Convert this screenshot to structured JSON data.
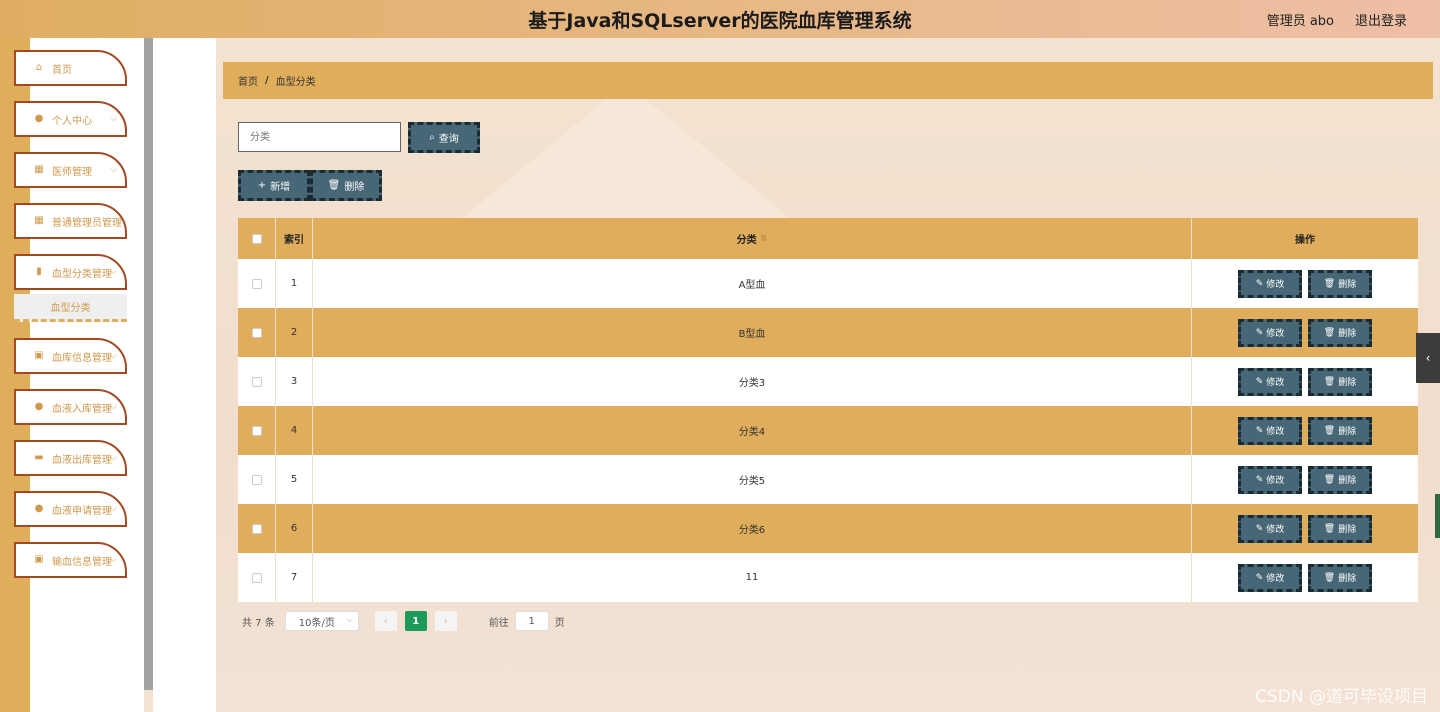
{
  "header": {
    "title": "基于Java和SQLserver的医院血库管理系统",
    "user": "管理员 abo",
    "logout": "退出登录"
  },
  "sidebar": {
    "items": [
      {
        "label": "首页",
        "icon": "home-icon",
        "glyph": "⌂",
        "chevron": false
      },
      {
        "label": "个人中心",
        "icon": "user-icon",
        "glyph": "●",
        "chevron": true
      },
      {
        "label": "医师管理",
        "icon": "grid-icon",
        "glyph": "▦",
        "chevron": true
      },
      {
        "label": "普通管理员管理",
        "icon": "grid-icon",
        "glyph": "▦",
        "chevron": false
      },
      {
        "label": "血型分类管理",
        "icon": "chart-icon",
        "glyph": "▮",
        "chevron": true
      },
      {
        "label": "血库信息管理",
        "icon": "clipboard-icon",
        "glyph": "▣",
        "chevron": true
      },
      {
        "label": "血液入库管理",
        "icon": "drop-icon",
        "glyph": "●",
        "chevron": true
      },
      {
        "label": "血液出库管理",
        "icon": "monitor-icon",
        "glyph": "▬",
        "chevron": true
      },
      {
        "label": "血液申请管理",
        "icon": "user-icon",
        "glyph": "●",
        "chevron": true
      },
      {
        "label": "输血信息管理",
        "icon": "clipboard-icon",
        "glyph": "▣",
        "chevron": true
      }
    ],
    "sub_item": "血型分类"
  },
  "breadcrumb": {
    "home": "首页",
    "sep": "/",
    "current": "血型分类"
  },
  "search": {
    "placeholder": "分类",
    "query_label": "查询"
  },
  "actions": {
    "add_label": "新增",
    "delete_label": "删除"
  },
  "table": {
    "columns": {
      "index": "索引",
      "name": "分类",
      "operation": "操作"
    },
    "rows": [
      {
        "index": "1",
        "name": "A型血"
      },
      {
        "index": "2",
        "name": "B型血"
      },
      {
        "index": "3",
        "name": "分类3"
      },
      {
        "index": "4",
        "name": "分类4"
      },
      {
        "index": "5",
        "name": "分类5"
      },
      {
        "index": "6",
        "name": "分类6"
      },
      {
        "index": "7",
        "name": "11"
      }
    ],
    "edit_label": "修改",
    "delete_label": "删除"
  },
  "pagination": {
    "total": "共 7 条",
    "page_size": "10条/页",
    "current_page": "1",
    "goto_label": "前往",
    "goto_value": "1",
    "page_suffix": "页"
  },
  "watermark": "CSDN @道可毕设项目",
  "colors": {
    "accent": "#dfad5b",
    "button": "#476777",
    "menu_border": "#a14a23",
    "active_page": "#1e9b5a"
  }
}
